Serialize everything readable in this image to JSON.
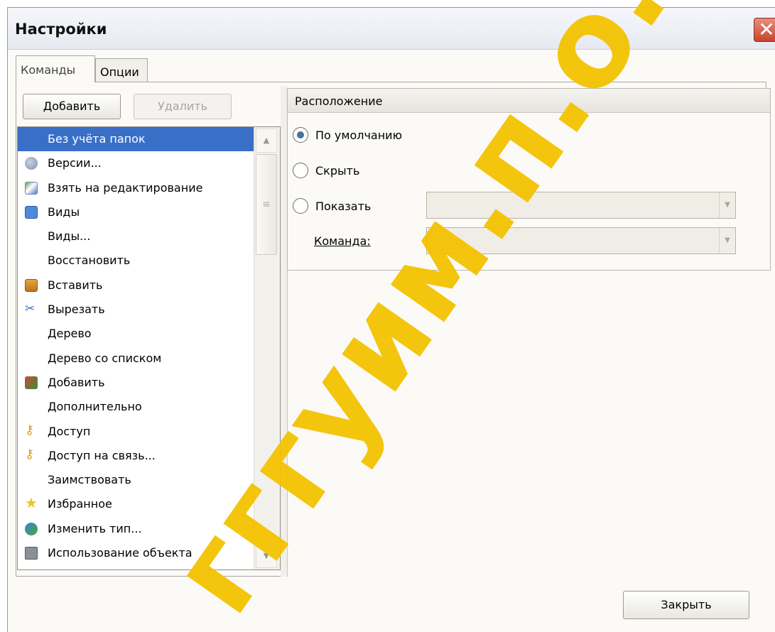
{
  "window": {
    "title": "Настройки",
    "close_glyph": "✕"
  },
  "tabs": [
    {
      "label": "Команды",
      "selected": true
    },
    {
      "label": "Опции",
      "selected": false
    }
  ],
  "buttons": {
    "add": "Добавить",
    "delete": "Удалить",
    "close": "Закрыть"
  },
  "commands": [
    {
      "label": "Без учёта папок",
      "icon": "none",
      "selected": true
    },
    {
      "label": "Версии...",
      "icon": "versions-icon"
    },
    {
      "label": "Взять на редактирование",
      "icon": "edit-icon"
    },
    {
      "label": "Виды",
      "icon": "views-icon"
    },
    {
      "label": "Виды...",
      "icon": "none"
    },
    {
      "label": "Восстановить",
      "icon": "none"
    },
    {
      "label": "Вставить",
      "icon": "paste-icon"
    },
    {
      "label": "Вырезать",
      "icon": "cut-icon"
    },
    {
      "label": "Дерево",
      "icon": "none"
    },
    {
      "label": "Дерево со списком",
      "icon": "none"
    },
    {
      "label": "Добавить",
      "icon": "add-tree-icon"
    },
    {
      "label": "Дополнительно",
      "icon": "none"
    },
    {
      "label": "Доступ",
      "icon": "key-icon"
    },
    {
      "label": "Доступ на связь...",
      "icon": "key-icon"
    },
    {
      "label": "Заимствовать",
      "icon": "none"
    },
    {
      "label": "Избранное",
      "icon": "star-icon"
    },
    {
      "label": "Изменить тип...",
      "icon": "change-type-icon"
    },
    {
      "label": "Использование объекта",
      "icon": "usage-icon"
    }
  ],
  "placement": {
    "header": "Расположение",
    "options": [
      {
        "label": "По умолчанию",
        "checked": true
      },
      {
        "label": "Скрыть",
        "checked": false
      },
      {
        "label": "Показать",
        "checked": false
      }
    ],
    "command_label": "Команда:",
    "show_value": "",
    "command_value": ""
  },
  "watermark": "гггуим.п.о.е"
}
